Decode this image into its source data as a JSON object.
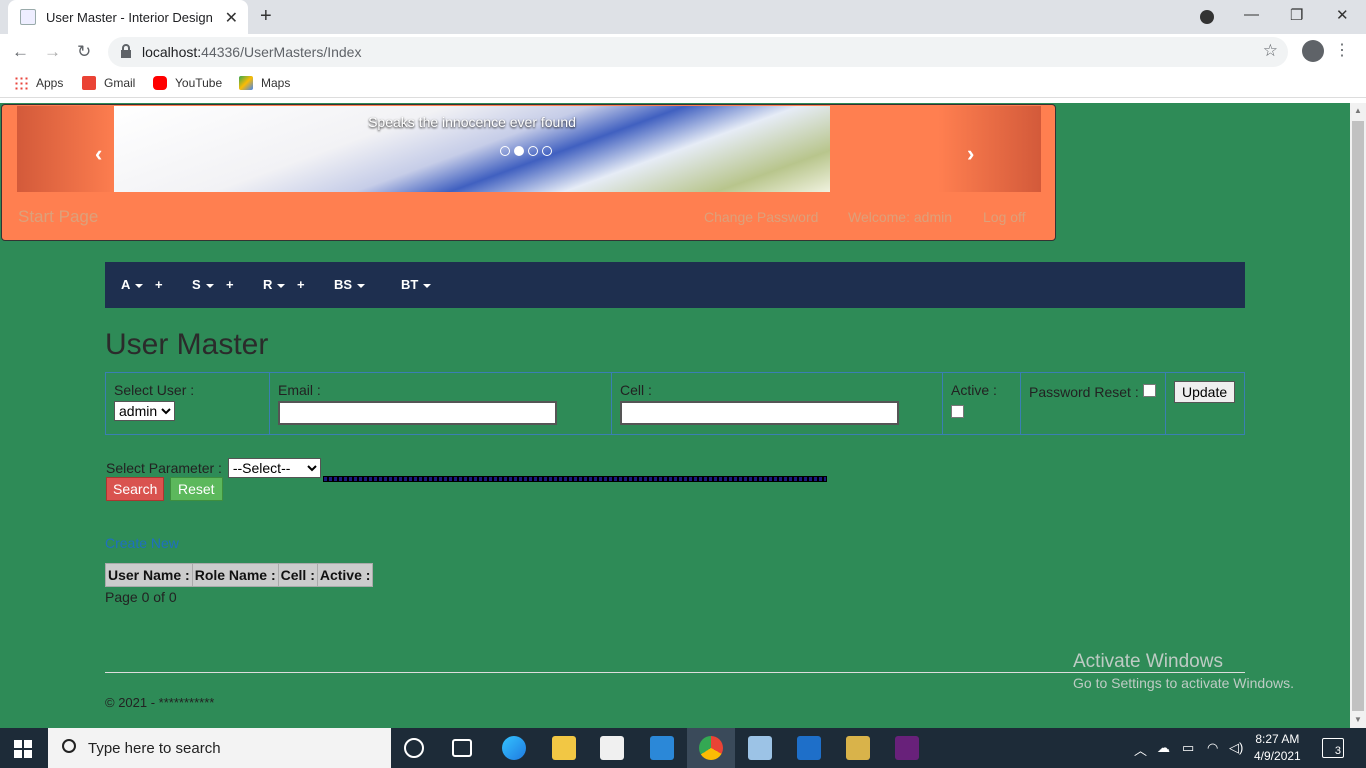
{
  "browser": {
    "tab_title": "User Master - Interior Design",
    "new_tab": "+",
    "url_host": "localhost:",
    "url_port_path": "44336/UserMasters/Index",
    "bookmarks": [
      "Apps",
      "Gmail",
      "YouTube",
      "Maps"
    ]
  },
  "banner": {
    "caption": "Speaks the innocence ever found",
    "brand": "Start Page",
    "links": [
      "Change Password",
      "Welcome: admin",
      "Log off"
    ],
    "slide_count": 4,
    "active_slide": 1
  },
  "nav": {
    "items": [
      {
        "label": "A",
        "plus": "+"
      },
      {
        "label": "S",
        "plus": "+"
      },
      {
        "label": "R",
        "plus": "+"
      },
      {
        "label": "BS",
        "plus": ""
      },
      {
        "label": "BT",
        "plus": ""
      }
    ]
  },
  "page": {
    "title": "User Master",
    "form": {
      "select_user_label": "Select User :",
      "select_user_value": "admin",
      "email_label": "Email :",
      "email_value": "",
      "cell_label": "Cell :",
      "cell_value": "",
      "active_label": "Active :",
      "password_reset_label": "Password Reset :",
      "update_button": "Update"
    },
    "search": {
      "param_label": "Select Parameter :",
      "param_value": "--Select--",
      "search_button": "Search",
      "reset_button": "Reset"
    },
    "create_new": "Create New",
    "grid_headers": [
      "User Name :",
      "Role Name :",
      "Cell :",
      "Active :"
    ],
    "pager": "Page 0 of 0",
    "footer": "© 2021 - ***********"
  },
  "watermark": {
    "line1": "Activate Windows",
    "line2": "Go to Settings to activate Windows."
  },
  "taskbar": {
    "search_placeholder": "Type here to search",
    "time": "8:27 AM",
    "date": "4/9/2021",
    "notifications": "3"
  }
}
